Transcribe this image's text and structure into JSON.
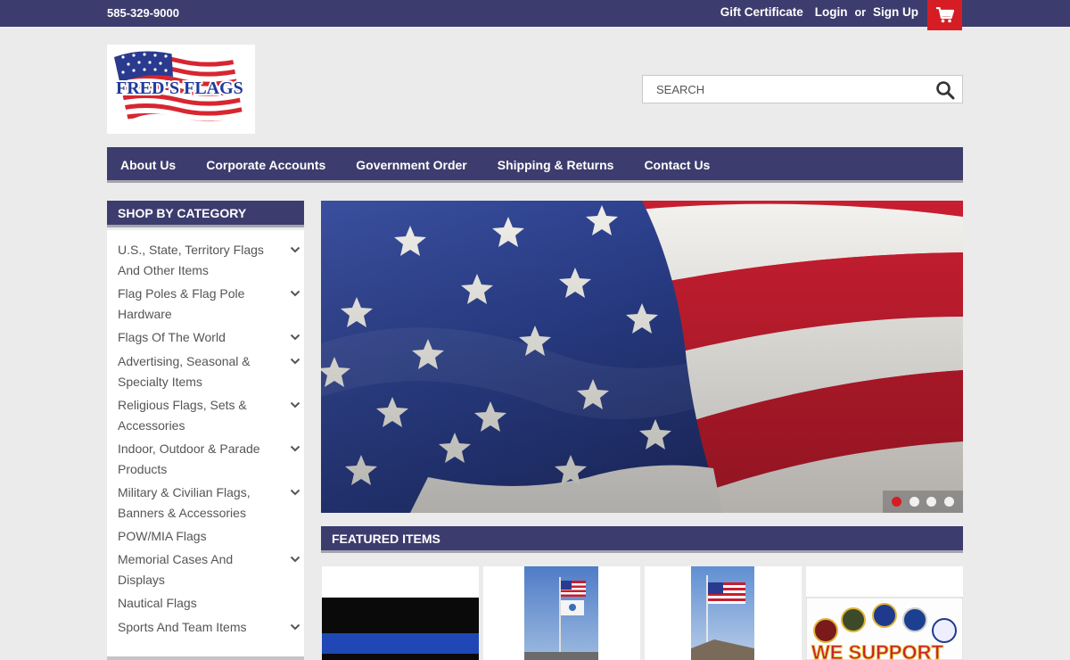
{
  "topbar": {
    "phone": "585-329-9000",
    "gift_certificate": "Gift Certificate",
    "login": "Login",
    "or": "or",
    "signup": "Sign Up",
    "cart_icon": "shopping-cart-icon"
  },
  "header": {
    "logo_text": "FRED'S FLAGS",
    "search_placeholder": "SEARCH",
    "search_icon": "magnifier-icon"
  },
  "nav": {
    "items": [
      "About Us",
      "Corporate Accounts",
      "Government Order",
      "Shipping & Returns",
      "Contact Us"
    ]
  },
  "sidebar": {
    "heading": "SHOP BY CATEGORY",
    "categories": [
      {
        "label": "U.S., State, Territory Flags And Other Items",
        "expandable": true
      },
      {
        "label": "Flag Poles & Flag Pole Hardware",
        "expandable": true
      },
      {
        "label": "Flags Of The World",
        "expandable": true
      },
      {
        "label": "Advertising, Seasonal & Specialty Items",
        "expandable": true
      },
      {
        "label": "Religious Flags, Sets & Accessories",
        "expandable": true
      },
      {
        "label": "Indoor, Outdoor & Parade Products",
        "expandable": true
      },
      {
        "label": "Military & Civilian Flags, Banners & Accessories",
        "expandable": true
      },
      {
        "label": "POW/MIA Flags",
        "expandable": false
      },
      {
        "label": "Memorial Cases And Displays",
        "expandable": true
      },
      {
        "label": "Nautical Flags",
        "expandable": false
      },
      {
        "label": "Sports And Team Items",
        "expandable": true
      }
    ]
  },
  "hero": {
    "slides": 4,
    "active_slide": 1
  },
  "featured": {
    "heading": "FEATURED ITEMS",
    "items": [
      {
        "image": "thin-blue-line-flag"
      },
      {
        "image": "flagpole-us-state-flags"
      },
      {
        "image": "flagpole-us-flag"
      },
      {
        "image": "we-support-military-banner",
        "caption": "WE SUPPORT"
      }
    ]
  },
  "colors": {
    "navy": "#3d3c6e",
    "red": "#d61d24",
    "background": "#ebebeb"
  }
}
